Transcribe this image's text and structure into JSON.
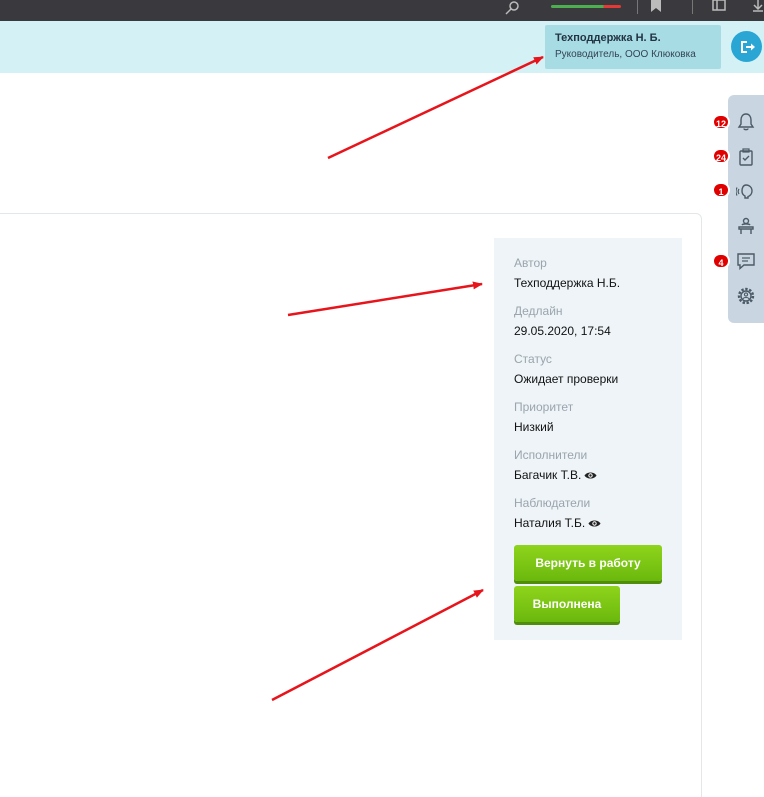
{
  "header": {
    "user_name": "Техподдержка Н. Б.",
    "user_role": "Руководитель, ООО Клюковка"
  },
  "rail": {
    "items": [
      {
        "icon": "bell-icon",
        "badge": "12"
      },
      {
        "icon": "clipboard-icon",
        "badge": "24"
      },
      {
        "icon": "support-icon",
        "badge": "1"
      },
      {
        "icon": "reception-icon",
        "badge": ""
      },
      {
        "icon": "chat-icon",
        "badge": "4"
      },
      {
        "icon": "gear-icon",
        "badge": ""
      }
    ]
  },
  "task": {
    "author_label": "Автор",
    "author_value": "Техподдержка Н.Б.",
    "deadline_label": "Дедлайн",
    "deadline_value": "29.05.2020, 17:54",
    "status_label": "Статус",
    "status_value": "Ожидает проверки",
    "priority_label": "Приоритет",
    "priority_value": "Низкий",
    "executors_label": "Исполнители",
    "executors_value": "Багачик Т.В.",
    "observers_label": "Наблюдатели",
    "observers_value": "Наталия Т.Б.",
    "return_button": "Вернуть в работу",
    "done_button": "Выполнена"
  },
  "colors": {
    "header_bg": "#d4f1f6",
    "accent": "#29a6d4",
    "button_green": "#7ac515",
    "badge_red": "#e00000",
    "arrow_red": "#e8141b"
  }
}
